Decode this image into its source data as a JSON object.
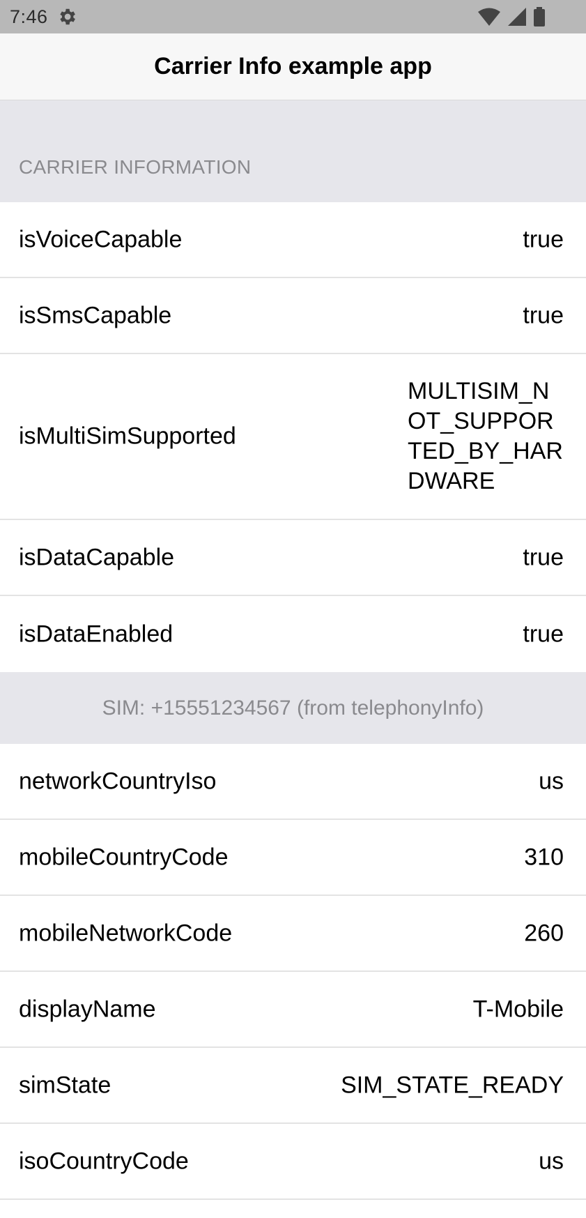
{
  "status_bar": {
    "time": "7:46",
    "icons": [
      "gear-icon",
      "wifi-icon",
      "cellular-signal-icon",
      "battery-icon"
    ]
  },
  "nav": {
    "title": "Carrier Info example app"
  },
  "carrier_section": {
    "title": "CARRIER INFORMATION",
    "rows": [
      {
        "label": "isVoiceCapable",
        "value": "true"
      },
      {
        "label": "isSmsCapable",
        "value": "true"
      },
      {
        "label": "isMultiSimSupported",
        "value": "MULTISIM_NOT_SUPPORTED_BY_HARDWARE"
      },
      {
        "label": "isDataCapable",
        "value": "true"
      },
      {
        "label": "isDataEnabled",
        "value": "true"
      }
    ]
  },
  "sim_section": {
    "title": "SIM: +15551234567 (from telephonyInfo)",
    "rows": [
      {
        "label": "networkCountryIso",
        "value": "us"
      },
      {
        "label": "mobileCountryCode",
        "value": "310"
      },
      {
        "label": "mobileNetworkCode",
        "value": "260"
      },
      {
        "label": "displayName",
        "value": "T-Mobile"
      },
      {
        "label": "simState",
        "value": "SIM_STATE_READY"
      },
      {
        "label": "isoCountryCode",
        "value": "us"
      }
    ]
  },
  "colors": {
    "status_bar_bg": "#b8b8b8",
    "nav_bg": "#f7f7f7",
    "section_bg": "#e6e6eb",
    "section_text": "#8a8a8e",
    "row_divider": "#e3e3e3"
  }
}
